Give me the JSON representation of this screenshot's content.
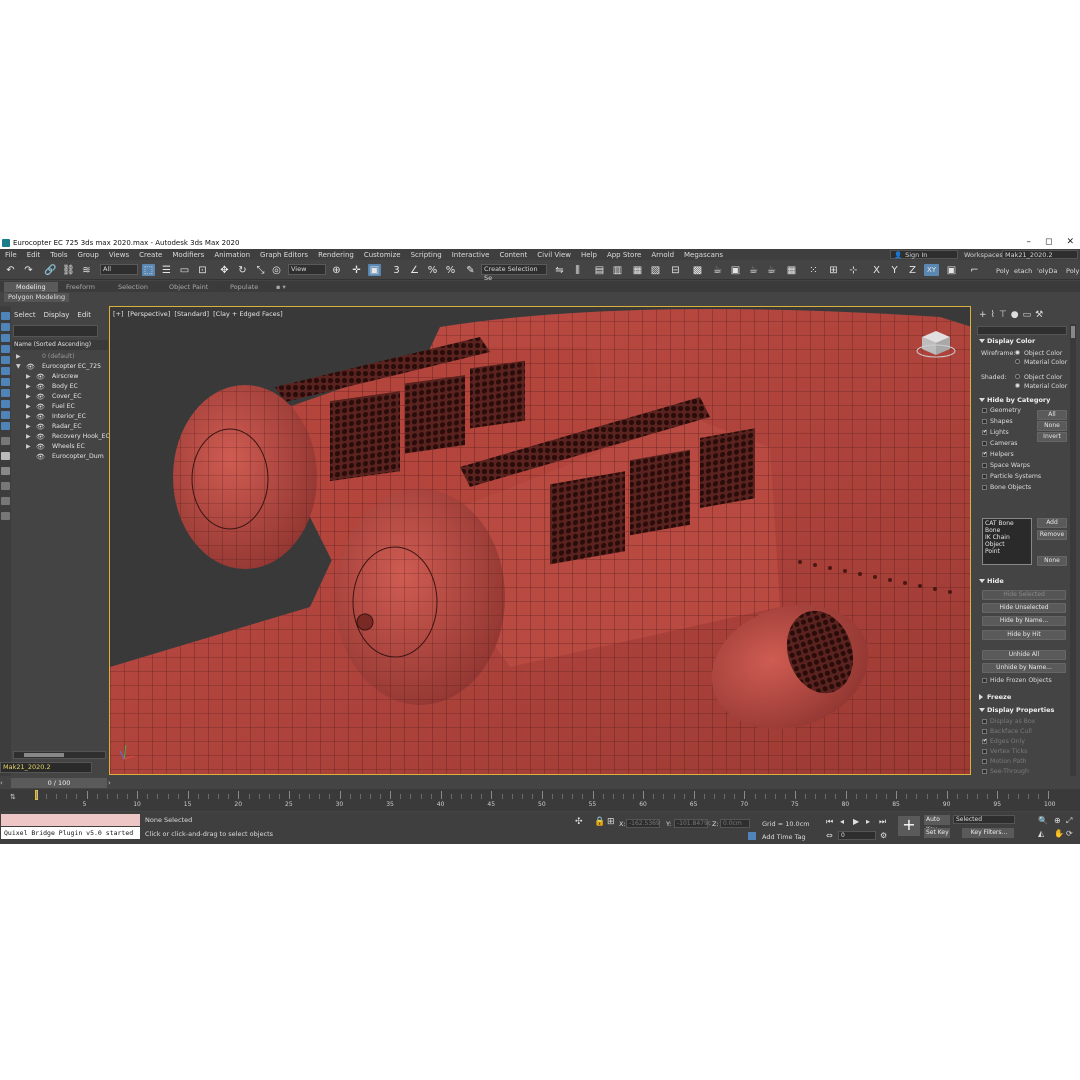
{
  "window": {
    "title": "Eurocopter EC 725 3ds max 2020.max - Autodesk 3ds Max 2020",
    "minimize": "–",
    "maximize": "◻",
    "close": "✕"
  },
  "menu": {
    "items": [
      "File",
      "Edit",
      "Tools",
      "Group",
      "Views",
      "Create",
      "Modifiers",
      "Animation",
      "Graph Editors",
      "Rendering",
      "Customize",
      "Scripting",
      "Interactive",
      "Content",
      "Civil View",
      "Help",
      "App Store",
      "Arnold",
      "Megascans"
    ],
    "sign_in": "Sign In",
    "workspaces_label": "Workspaces:",
    "workspace_value": "Mak21_2020.2"
  },
  "toolbar": {
    "filter_value": "All",
    "ref_coord_value": "View",
    "snap_labels": [
      "3",
      "%",
      "%"
    ],
    "selection_set_placeholder": "Create Selection Se",
    "axis_labels": [
      "X",
      "Y",
      "Z",
      "XY"
    ],
    "right_labels": [
      "Poly",
      "etach",
      "'olyDa",
      "Poly"
    ]
  },
  "ribbon": {
    "tabs": [
      "Modeling",
      "Freeform",
      "Selection",
      "Object Paint",
      "Populate"
    ],
    "active_tab": "Modeling",
    "sub_label": "Polygon Modeling"
  },
  "explorer": {
    "menu": [
      "Select",
      "Display",
      "Edit"
    ],
    "header": "Name (Sorted Ascending)",
    "rows": [
      {
        "label": "0 (default)",
        "indent": 0,
        "arrow": "▶",
        "eye": ""
      },
      {
        "label": "Eurocopter EC_725",
        "indent": 0,
        "arrow": "▼",
        "eye": "👁"
      },
      {
        "label": "Airscrew",
        "indent": 1,
        "arrow": "▶",
        "eye": "👁"
      },
      {
        "label": "Body EC",
        "indent": 1,
        "arrow": "▶",
        "eye": "👁"
      },
      {
        "label": "Cover_EC",
        "indent": 1,
        "arrow": "▶",
        "eye": "👁"
      },
      {
        "label": "Fuel EC",
        "indent": 1,
        "arrow": "▶",
        "eye": "👁"
      },
      {
        "label": "Interior_EC",
        "indent": 1,
        "arrow": "▶",
        "eye": "👁"
      },
      {
        "label": "Radar_EC",
        "indent": 1,
        "arrow": "▶",
        "eye": "👁"
      },
      {
        "label": "Recovery Hook_EC",
        "indent": 1,
        "arrow": "▶",
        "eye": "👁"
      },
      {
        "label": "Wheels EC",
        "indent": 1,
        "arrow": "▶",
        "eye": "👁"
      },
      {
        "label": "Eurocopter_Dum",
        "indent": 1,
        "arrow": "",
        "eye": "👁"
      }
    ],
    "layer_value": "Mak21_2020.2"
  },
  "viewport": {
    "labels": [
      "[+]",
      "[Perspective]",
      "[Standard]",
      "[Clay + Edged Faces]"
    ],
    "model_color": "#b8473f",
    "grille_color": "#4a1a16"
  },
  "command_panel": {
    "display_color": {
      "title": "Display Color",
      "wireframe_label": "Wireframe:",
      "shaded_label": "Shaded:",
      "object_color": "Object Color",
      "material_color": "Material Color"
    },
    "hide_by_category": {
      "title": "Hide by Category",
      "items": [
        {
          "label": "Geometry",
          "checked": false
        },
        {
          "label": "Shapes",
          "checked": false
        },
        {
          "label": "Lights",
          "checked": true
        },
        {
          "label": "Cameras",
          "checked": false
        },
        {
          "label": "Helpers",
          "checked": true
        },
        {
          "label": "Space Warps",
          "checked": false
        },
        {
          "label": "Particle Systems",
          "checked": false
        },
        {
          "label": "Bone Objects",
          "checked": false
        }
      ],
      "btn_all": "All",
      "btn_none": "None",
      "btn_invert": "Invert",
      "list": [
        "CAT Bone",
        "Bone",
        "IK Chain Object",
        "Point"
      ],
      "btn_add": "Add",
      "btn_remove": "Remove",
      "btn_none2": "None"
    },
    "hide": {
      "title": "Hide",
      "buttons": [
        "Hide Selected",
        "Hide Unselected",
        "Hide by Name...",
        "Hide by Hit",
        "Unhide All",
        "Unhide by Name..."
      ],
      "frozen_label": "Hide Frozen Objects"
    },
    "freeze_title": "Freeze",
    "display_properties": {
      "title": "Display Properties",
      "items": [
        "Display as Box",
        "Backface Cull",
        "Edges Only",
        "Vertex Ticks",
        "Motion Path",
        "See-Through"
      ]
    }
  },
  "timeline": {
    "frame_display": "0 / 100",
    "ticks": [
      "5",
      "10",
      "15",
      "20",
      "25",
      "30",
      "35",
      "40",
      "45",
      "50",
      "55",
      "60",
      "65",
      "70",
      "75",
      "80",
      "85",
      "90",
      "95",
      "100"
    ]
  },
  "status": {
    "listener_text": "Quixel Bridge Plugin v5.0 started",
    "selection": "None Selected",
    "prompt": "Click or click-and-drag to select objects",
    "x_label": "X:",
    "x_value": "-162.5369",
    "y_label": "Y:",
    "y_value": "-101.8479c",
    "z_label": "Z:",
    "z_value": "0.0cm",
    "grid": "Grid = 10.0cm",
    "add_time_tag": "Add Time Tag",
    "frame_field": "0",
    "auto_key": "Auto Key",
    "selected_value": "Selected",
    "set_key": "Set Key",
    "key_filters": "Key Filters..."
  }
}
